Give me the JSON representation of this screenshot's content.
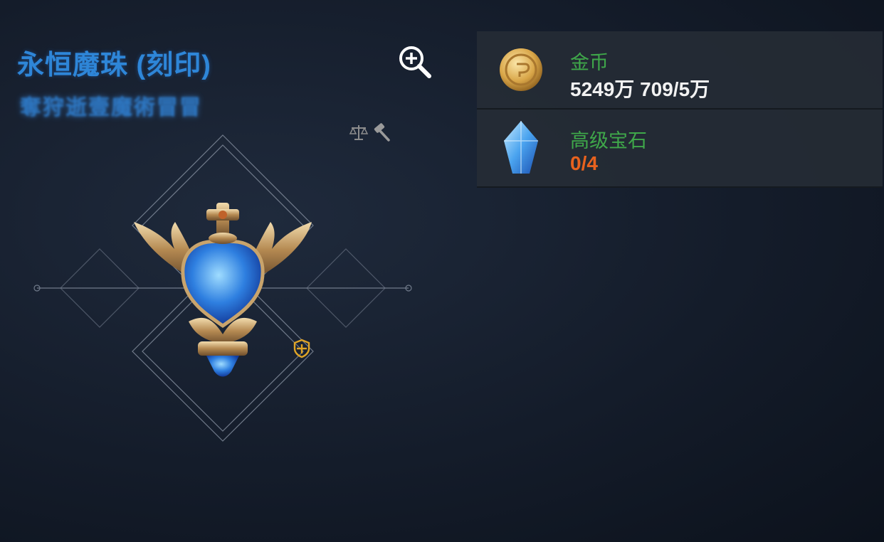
{
  "item": {
    "title": "永恒魔珠 (刻印)",
    "subtitle": "奪狩逝壹魔術冒冒",
    "emblem_icon": "winged-sapphire-orb-emblem",
    "badge_icon": "shield-plus-icon",
    "zoom_icon": "zoom-in-icon"
  },
  "resources": [
    {
      "name": "金币",
      "value": "5249万 709/5万",
      "icon": "gold-coin-icon",
      "value_color": "#f2f2f2"
    },
    {
      "name": "高级宝石",
      "value": "0/4",
      "icon": "blue-crystal-icon",
      "value_color": "#e8621e"
    }
  ],
  "actions": {
    "scale_icon": "balance-scale-icon",
    "hammer_icon": "hammer-icon"
  },
  "colors": {
    "title": "#2e86d8",
    "resource_name": "#3fa84a",
    "insufficient": "#e8621e",
    "panel_bg": "#262c36"
  }
}
